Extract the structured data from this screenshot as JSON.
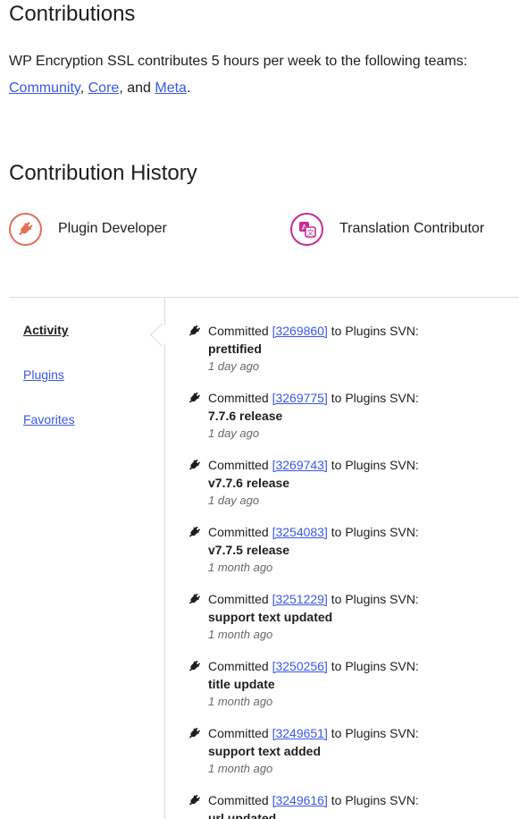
{
  "contributions": {
    "title": "Contributions",
    "intro_text": "WP Encryption SSL contributes 5 hours per week to the following teams:",
    "teams": [
      "Community",
      "Core",
      "Meta"
    ],
    "sep1": ",",
    "sep2": ", and",
    "end": "."
  },
  "history": {
    "title": "Contribution History",
    "badges": [
      {
        "label": "Plugin Developer",
        "icon": "plugin-icon",
        "color": "#e26f56"
      },
      {
        "label": "Translation Contributor",
        "icon": "translate-icon",
        "color": "#c52d93"
      }
    ]
  },
  "sidebar": {
    "items": [
      {
        "label": "Activity",
        "active": true
      },
      {
        "label": "Plugins",
        "active": false
      },
      {
        "label": "Favorites",
        "active": false
      }
    ]
  },
  "activity": {
    "committed": "Committed",
    "target": "to Plugins SVN:",
    "entries": [
      {
        "rev": "[3269860]",
        "message": "prettified",
        "time": "1 day ago"
      },
      {
        "rev": "[3269775]",
        "message": "7.7.6 release",
        "time": "1 day ago"
      },
      {
        "rev": "[3269743]",
        "message": "v7.7.6 release",
        "time": "1 day ago"
      },
      {
        "rev": "[3254083]",
        "message": "v7.7.5 release",
        "time": "1 month ago"
      },
      {
        "rev": "[3251229]",
        "message": "support text updated",
        "time": "1 month ago"
      },
      {
        "rev": "[3250256]",
        "message": "title update",
        "time": "1 month ago"
      },
      {
        "rev": "[3249651]",
        "message": "support text added",
        "time": "1 month ago"
      },
      {
        "rev": "[3249616]",
        "message": "url updated",
        "time": ""
      }
    ]
  },
  "colors": {
    "link": "#3858e9",
    "text": "#1e1e1e",
    "muted": "#646970"
  }
}
